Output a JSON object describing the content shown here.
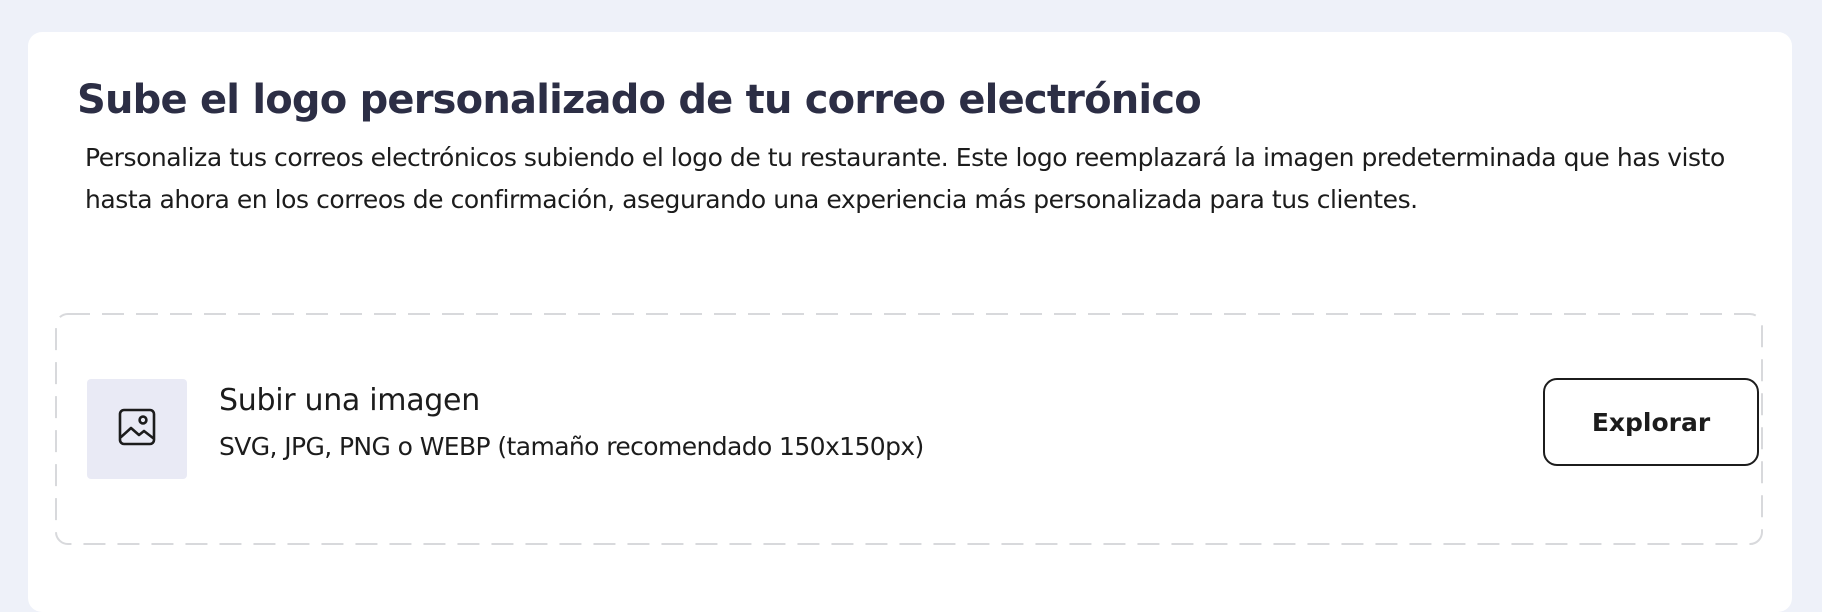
{
  "upload_logo": {
    "title": "Sube el logo personalizado de tu correo electrónico",
    "description": "Personaliza tus correos electrónicos subiendo el logo de tu restaurante. Este logo reemplazará la imagen predeterminada que has visto hasta ahora en los correos de confirmación, asegurando una experiencia más personalizada para tus clientes.",
    "dropzone": {
      "icon": "image-icon",
      "title": "Subir una imagen",
      "hint": "SVG, JPG, PNG o WEBP (tamaño recomendado 150x150px)",
      "browse_label": "Explorar"
    }
  },
  "colors": {
    "page_background": "#eef1f9",
    "card_background": "#ffffff",
    "title_text": "#2c2e45",
    "body_text": "#1c1c1c",
    "icon_tile": "#e9eaf5",
    "dashed_border": "#d8d9dc"
  }
}
